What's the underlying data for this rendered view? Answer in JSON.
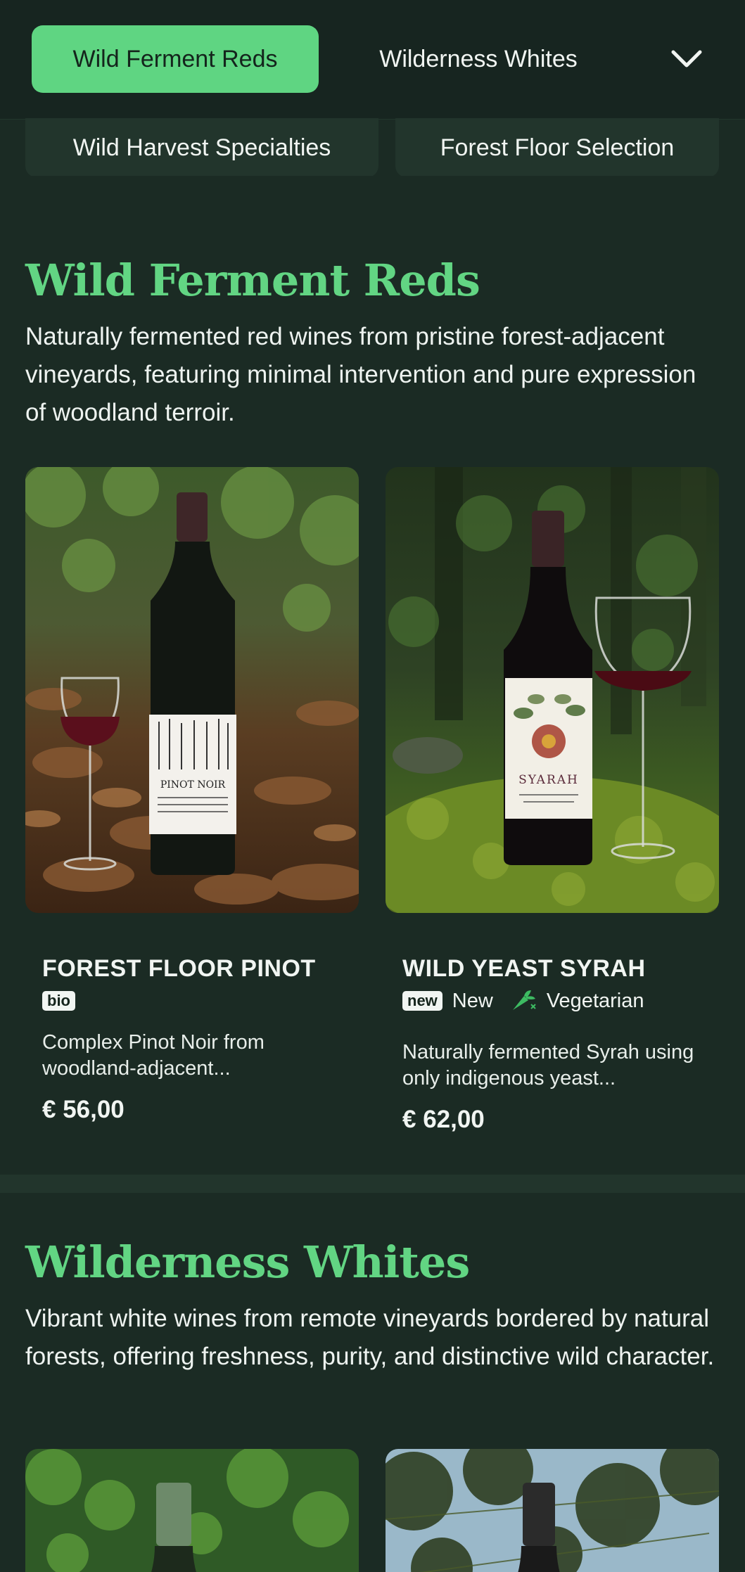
{
  "nav": {
    "tabs": [
      {
        "label": "Wild Ferment Reds"
      },
      {
        "label": "Wilderness Whites"
      },
      {
        "label": "Wild Harvest Specialties"
      },
      {
        "label": "Forest Floor Selection"
      }
    ],
    "expand_icon": "chevron-down-icon"
  },
  "sections": [
    {
      "title": "Wild Ferment Reds",
      "description": "Naturally fermented red wines from pristine forest-adjacent vineyards, featuring minimal intervention and pure expression of woodland terroir.",
      "products": [
        {
          "name": "FOREST FLOOR PINOT",
          "badges": [
            {
              "tag": "bio"
            }
          ],
          "description": "Complex Pinot Noir from woodland-adjacent...",
          "price": "€ 56,00",
          "label_text": "PINOT NOIR"
        },
        {
          "name": "WILD YEAST SYRAH",
          "badges": [
            {
              "tag": "new",
              "text": "New"
            },
            {
              "icon": "leaf-carrot-icon",
              "text": "Vegetarian"
            }
          ],
          "description": "Naturally fermented Syrah using only indigenous yeast...",
          "price": "€ 62,00",
          "label_text": "SYARAH"
        }
      ]
    },
    {
      "title": "Wilderness Whites",
      "description": "Vibrant white wines from remote vineyards bordered by natural forests, offering freshness, purity, and distinctive wild character."
    }
  ],
  "colors": {
    "background": "#1b2b24",
    "accent": "#5fd582",
    "heading": "#62d583",
    "nav_bg": "#172520"
  }
}
